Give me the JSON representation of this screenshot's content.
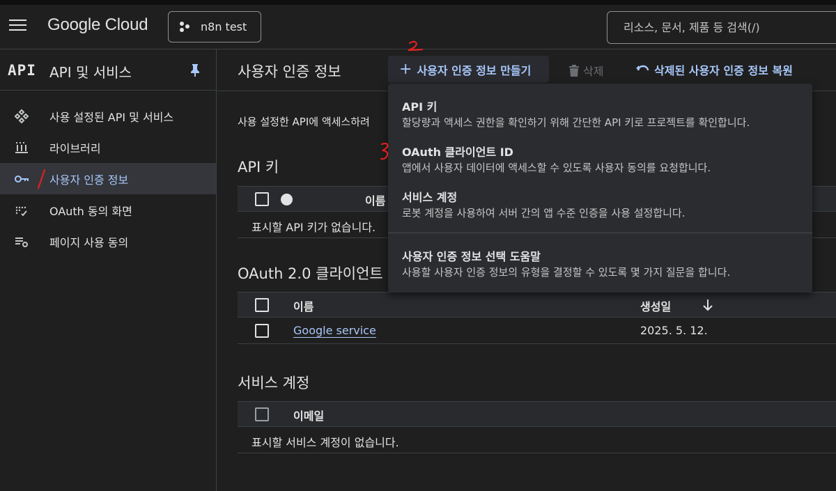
{
  "topbar": {
    "logo": "Google Cloud",
    "project_label": "n8n test",
    "search_placeholder": "리소스, 문서, 제품 등 검색(/)"
  },
  "sidebar": {
    "badge": "API",
    "title": "API 및 서비스",
    "items": [
      {
        "label": "사용 설정된 API 및 서비스",
        "icon": "hub-icon",
        "active": false
      },
      {
        "label": "라이브러리",
        "icon": "library-icon",
        "active": false
      },
      {
        "label": "사용자 인증 정보",
        "icon": "key-icon",
        "active": true
      },
      {
        "label": "OAuth 동의 화면",
        "icon": "consent-icon",
        "active": false
      },
      {
        "label": "페이지 사용 동의",
        "icon": "settings-list-icon",
        "active": false
      }
    ]
  },
  "header": {
    "title": "사용자 인증 정보",
    "create_label": "사용자 인증 정보 만들기",
    "delete_label": "삭제",
    "restore_label": "삭제된 사용자 인증 정보 복원"
  },
  "intro_text": "사용 설정한 API에 액세스하려",
  "api_keys": {
    "title": "API 키",
    "col_name": "이름",
    "empty": "표시할 API 키가 없습니다."
  },
  "oauth": {
    "title": "OAuth 2.0 클라이언트",
    "col_name": "이름",
    "col_created": "생성일",
    "rows": [
      {
        "name": "Google service",
        "created": "2025. 5. 12."
      }
    ]
  },
  "service_accounts": {
    "title": "서비스 계정",
    "col_email": "이메일",
    "empty": "표시할 서비스 계정이 없습니다."
  },
  "menu": {
    "items": [
      {
        "title": "API 키",
        "desc": "할당량과 액세스 권한을 확인하기 위해 간단한 API 키로 프로젝트를 확인합니다."
      },
      {
        "title": "OAuth 클라이언트 ID",
        "desc": "앱에서 사용자 데이터에 액세스할 수 있도록 사용자 동의를 요청합니다."
      },
      {
        "title": "서비스 계정",
        "desc": "로봇 계정을 사용하여 서버 간의 앱 수준 인증을 사용 설정합니다."
      },
      {
        "title": "사용자 인증 정보 선택 도움말",
        "desc": "사용할 사용자 인증 정보의 유형을 결정할 수 있도록 몇 가지 질문을 합니다."
      }
    ]
  },
  "colors": {
    "background": "#1f1f1f",
    "accent": "#a8c7fa",
    "annotation": "#e02020"
  }
}
